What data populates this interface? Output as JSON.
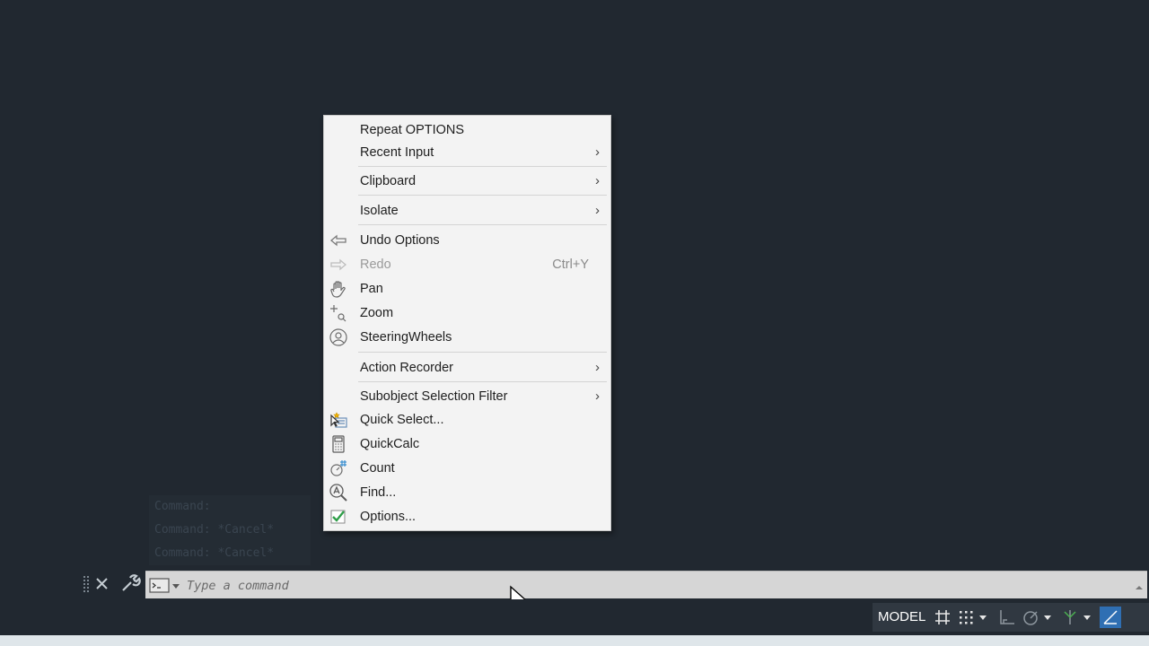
{
  "command_history": [
    "Command:",
    "Command: *Cancel*",
    "Command: *Cancel*"
  ],
  "context_menu": {
    "items": [
      {
        "label": "Repeat OPTIONS"
      },
      {
        "label": "Recent Input"
      },
      {
        "label": "Clipboard"
      },
      {
        "label": "Isolate"
      },
      {
        "label": "Undo Options",
        "icon": "undo-icon"
      },
      {
        "label": "Redo",
        "shortcut": "Ctrl+Y",
        "icon": "redo-icon",
        "disabled": true
      },
      {
        "label": "Pan",
        "icon": "pan-hand-icon"
      },
      {
        "label": "Zoom",
        "icon": "zoom-icon"
      },
      {
        "label": "SteeringWheels",
        "icon": "steering-wheel-icon"
      },
      {
        "label": "Action Recorder"
      },
      {
        "label": "Subobject Selection Filter"
      },
      {
        "label": "Quick Select...",
        "icon": "quick-select-icon"
      },
      {
        "label": "QuickCalc",
        "icon": "calculator-icon"
      },
      {
        "label": "Count",
        "icon": "count-icon"
      },
      {
        "label": "Find...",
        "icon": "find-icon"
      },
      {
        "label": "Options...",
        "icon": "checkmark-icon"
      }
    ],
    "submenu_arrow": "›"
  },
  "command_line": {
    "placeholder": "Type a command"
  },
  "status_bar": {
    "model_label": "MODEL"
  },
  "colors": {
    "canvas": "#212830",
    "menu_bg": "#f3f3f3",
    "command_bar": "#d6d6d6",
    "checkmark": "#2e9e48",
    "accent_blue": "#2f6fb3"
  }
}
